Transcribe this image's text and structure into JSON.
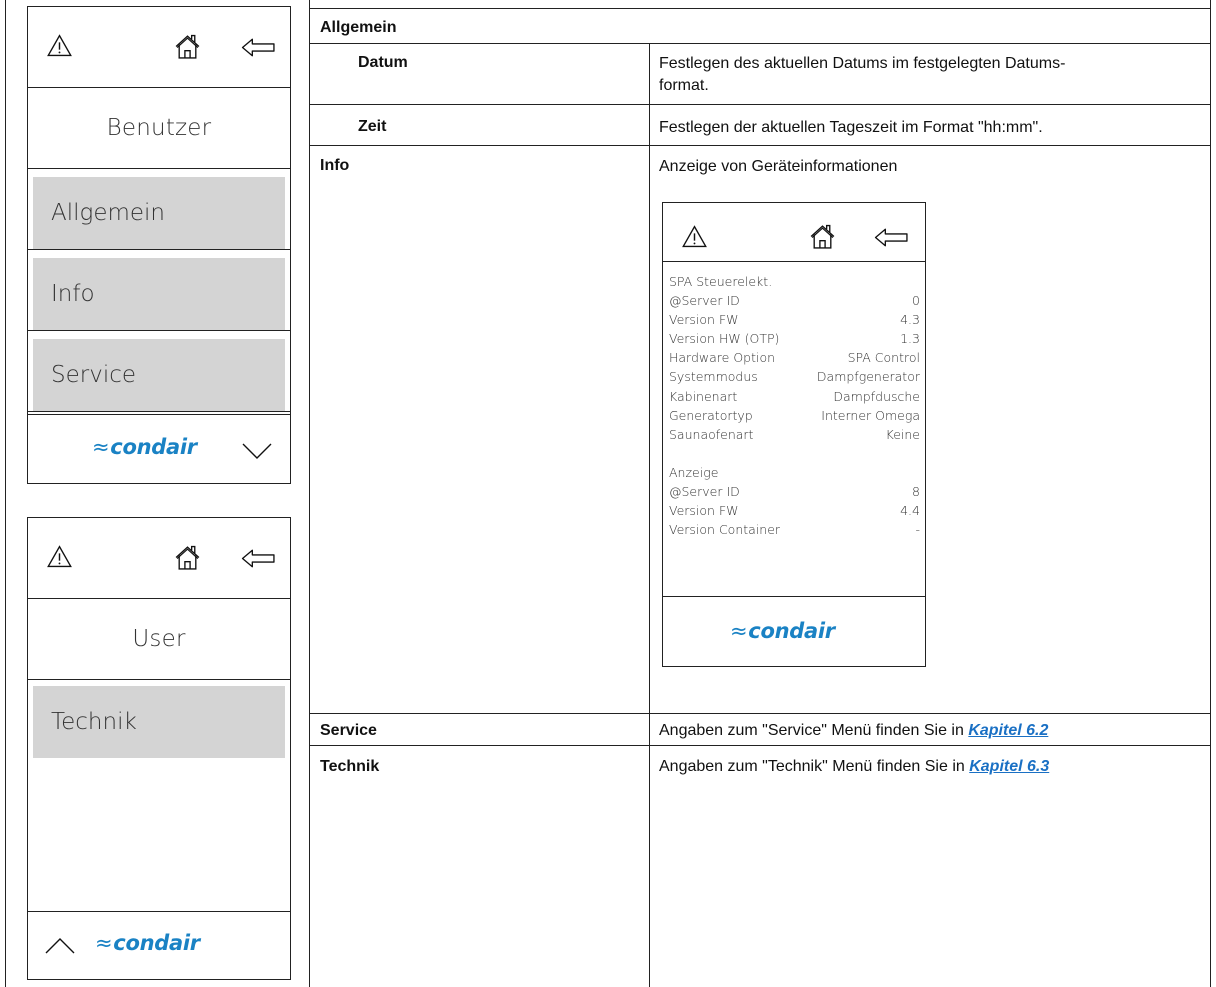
{
  "device_top": {
    "title": "Benutzer",
    "items": [
      {
        "label": "Allgemein"
      },
      {
        "label": "Info"
      },
      {
        "label": "Service"
      }
    ]
  },
  "device_bottom": {
    "title": "User",
    "items": [
      {
        "label": "Technik"
      }
    ]
  },
  "brand": {
    "name": "condair",
    "waves": "≈"
  },
  "table": {
    "section_title": "Allgemein",
    "rows": [
      {
        "name": "Datum",
        "description": "Festlegen des aktuellen Datums im festgelegten Datums-\nformat."
      },
      {
        "name": "Zeit",
        "description": "Festlegen der aktuellen Tageszeit im Format \"hh:mm\"."
      },
      {
        "name": "Info",
        "description": "Anzeige von Geräteinformationen"
      },
      {
        "name": "Service",
        "description": "Angaben zum \"Service\" Menü finden Sie in ",
        "link": "Kapitel 6.2"
      },
      {
        "name": "Technik",
        "description": "Angaben zum \"Technik\" Menü finden Sie in ",
        "link": "Kapitel 6.3"
      }
    ]
  },
  "info_screen": {
    "group1_title": "SPA Steuerelekt.",
    "group1": [
      {
        "label": "@Server ID",
        "value": "0"
      },
      {
        "label": "Version FW",
        "value": "4.3"
      },
      {
        "label": "Version HW (OTP)",
        "value": "1.3"
      },
      {
        "label": "Hardware Option",
        "value": "SPA Control"
      },
      {
        "label": "Systemmodus",
        "value": "Dampfgenerator"
      },
      {
        "label": "Kabinenart",
        "value": "Dampfdusche"
      },
      {
        "label": "Generatortyp",
        "value": "Interner Omega"
      },
      {
        "label": "Saunaofenart",
        "value": "Keine"
      }
    ],
    "group2_title": "Anzeige",
    "group2": [
      {
        "label": "@Server ID",
        "value": "8"
      },
      {
        "label": "Version FW",
        "value": "4.4"
      },
      {
        "label": "Version Container",
        "value": "-"
      }
    ]
  },
  "colors": {
    "brand": "#1a82c4",
    "link": "#1a70c4",
    "menu_item_bg": "#d4d4d4"
  },
  "icons": [
    "warning-icon",
    "home-icon",
    "back-arrow-icon",
    "chevron-down-icon",
    "chevron-up-icon"
  ]
}
